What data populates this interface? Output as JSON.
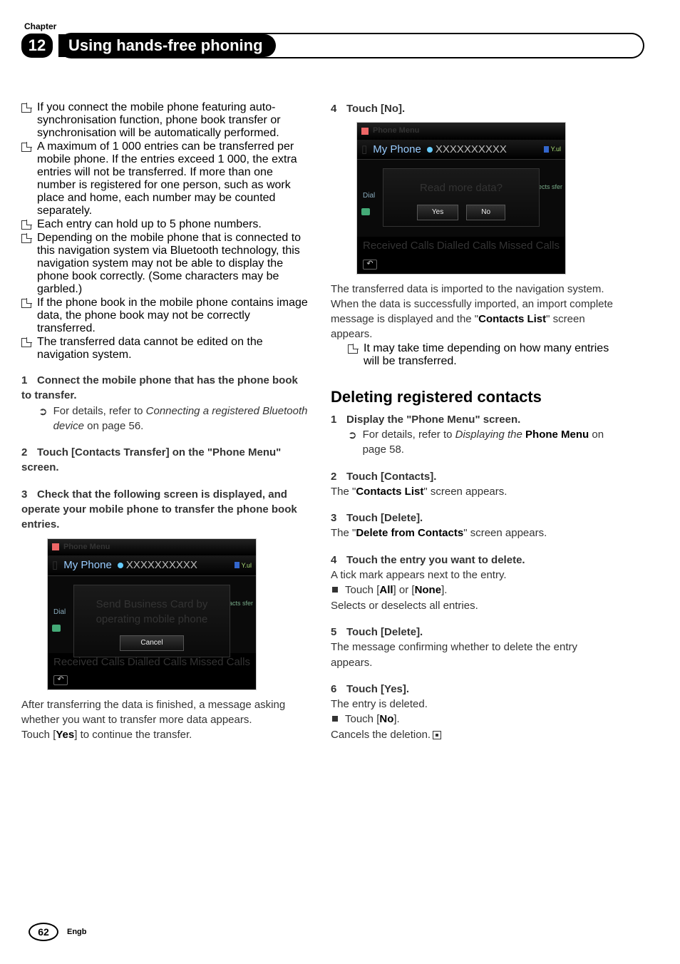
{
  "chapter": {
    "label": "Chapter",
    "number": "12",
    "title": "Using hands-free phoning"
  },
  "left": {
    "bullets": [
      "If you connect the mobile phone featuring auto-synchronisation function, phone book transfer or synchronisation will be automatically performed.",
      "A maximum of 1 000 entries can be transferred per mobile phone. If the entries exceed 1 000, the extra entries will not be transferred. If more than one number is registered for one person, such as work place and home, each number may be counted separately.",
      "Each entry can hold up to 5 phone numbers.",
      "Depending on the mobile phone that is connected to this navigation system via Bluetooth technology, this navigation system may not be able to display the phone book correctly. (Some characters may be garbled.)",
      "If the phone book in the mobile phone contains image data, the phone book may not be correctly transferred.",
      "The transferred data cannot be edited on the navigation system."
    ],
    "step1": {
      "num": "1",
      "head": "Connect the mobile phone that has the phone book to transfer."
    },
    "step1_detail_a": "For details, refer to ",
    "step1_detail_b": "Connecting a registered Bluetooth device",
    "step1_detail_c": " on page 56.",
    "step2": {
      "num": "2",
      "head": "Touch [Contacts Transfer] on the \"Phone Menu\" screen."
    },
    "step3": {
      "num": "3",
      "head": "Check that the following screen is displayed, and operate your mobile phone to transfer the phone book entries."
    },
    "after_a": "After transferring the data is finished, a message asking whether you want to transfer more data appears.",
    "after_b_a": "Touch [",
    "after_b_b": "Yes",
    "after_b_c": "] to continue the transfer."
  },
  "right": {
    "step4": {
      "num": "4",
      "head": "Touch [No]."
    },
    "imported_a": "The transferred data is imported to the navigation system.",
    "imported_b_a": "When the data is successfully imported, an import complete message is displayed and the \"",
    "imported_b_b": "Contacts List",
    "imported_b_c": "\" screen appears.",
    "bullet": "It may take time depending on how many entries will be transferred.",
    "subheading": "Deleting registered contacts",
    "d1": {
      "num": "1",
      "head": "Display the \"Phone Menu\" screen."
    },
    "d1_detail_a": "For details, refer to ",
    "d1_detail_b": "Displaying the ",
    "d1_detail_c": "Phone Menu",
    "d1_detail_d": " on page 58.",
    "d2": {
      "num": "2",
      "head": "Touch [Contacts]."
    },
    "d2_body_a": "The \"",
    "d2_body_b": "Contacts List",
    "d2_body_c": "\" screen appears.",
    "d3": {
      "num": "3",
      "head": "Touch [Delete]."
    },
    "d3_body_a": "The \"",
    "d3_body_b": "Delete from Contacts",
    "d3_body_c": "\" screen appears.",
    "d4": {
      "num": "4",
      "head": "Touch the entry you want to delete."
    },
    "d4_body": "A tick mark appears next to the entry.",
    "d4_sq_a": "Touch [",
    "d4_sq_b": "All",
    "d4_sq_c": "] or [",
    "d4_sq_d": "None",
    "d4_sq_e": "].",
    "d4_exp": "Selects or deselects all entries.",
    "d5": {
      "num": "5",
      "head": "Touch [Delete]."
    },
    "d5_body": "The message confirming whether to delete the entry appears.",
    "d6": {
      "num": "6",
      "head": "Touch [Yes]."
    },
    "d6_body": "The entry is deleted.",
    "d6_sq_a": "Touch [",
    "d6_sq_b": "No",
    "d6_sq_c": "].",
    "d6_exp": "Cancels the deletion."
  },
  "ss1": {
    "title": "Phone Menu",
    "myphone": "My Phone",
    "xs": "XXXXXXXXXX",
    "signal": "Y.ul",
    "dial": "Dial",
    "right_chip": "acts\nsfer",
    "modal_text": "Send Business Card by operating mobile phone",
    "btn_cancel": "Cancel",
    "f1": "Received Calls",
    "f2": "Dialled Calls",
    "f3": "Missed Calls"
  },
  "ss2": {
    "title": "Phone Menu",
    "myphone": "My Phone",
    "xs": "XXXXXXXXXX",
    "signal": "Y.ul",
    "dial": "Dial",
    "right_chip": "ects\nsfer",
    "modal_text": "Read more data?",
    "btn_yes": "Yes",
    "btn_no": "No",
    "f1": "Received Calls",
    "f2": "Dialled Calls",
    "f3": "Missed Calls"
  },
  "footer": {
    "page": "62",
    "lang": "Engb"
  }
}
